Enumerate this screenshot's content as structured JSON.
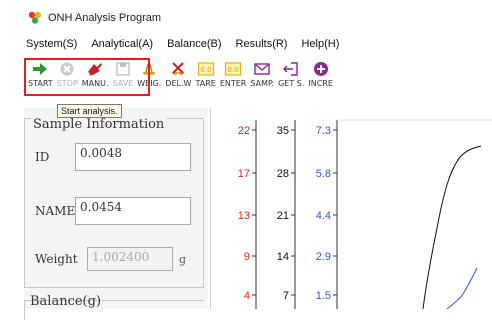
{
  "app": {
    "title": "ONH Analysis Program"
  },
  "menu": [
    "System(S)",
    "Analytical(A)",
    "Balance(B)",
    "Results(R)",
    "Help(H)"
  ],
  "toolbar": {
    "buttons": [
      {
        "label": "START",
        "icon": "arrow-right-icon",
        "enabled": true
      },
      {
        "label": "STOP",
        "icon": "stop-icon",
        "enabled": false
      },
      {
        "label": "MANU.",
        "icon": "manual-icon",
        "enabled": true
      },
      {
        "label": "SAVE",
        "icon": "save-icon",
        "enabled": false
      },
      {
        "label": "WEIG.",
        "icon": "weigh-icon",
        "enabled": true
      },
      {
        "label": "DEL.W",
        "icon": "delete-weigh-icon",
        "enabled": true
      },
      {
        "label": "TARE",
        "icon": "tare-icon",
        "enabled": true
      },
      {
        "label": "ENTER",
        "icon": "enter-icon",
        "enabled": true
      },
      {
        "label": "SAMP.",
        "icon": "sample-icon",
        "enabled": true
      },
      {
        "label": "GET S.",
        "icon": "get-sample-icon",
        "enabled": true
      },
      {
        "label": "INCRE",
        "icon": "increment-icon",
        "enabled": true
      }
    ],
    "tooltip": "Start analysis."
  },
  "sample_info": {
    "title": "Sample Information",
    "id_label": "ID",
    "id_value": "0.0048",
    "name_label": "NAME",
    "name_value": "0.0454",
    "weight_label": "Weight",
    "weight_value": "1.002400",
    "weight_unit": "g"
  },
  "balance": {
    "title": "Balance(g)"
  },
  "chart": {
    "axes": [
      {
        "color": "#e02020",
        "ticks": [
          "22",
          "17",
          "13",
          "9",
          "4"
        ]
      },
      {
        "color": "#111111",
        "ticks": [
          "35",
          "28",
          "21",
          "14",
          "7"
        ]
      },
      {
        "color": "#3355cc",
        "ticks": [
          "7.3",
          "5.8",
          "4.4",
          "2.9",
          "1.5"
        ]
      }
    ]
  },
  "colors": {
    "highlight": "#e02020",
    "accent_blue": "#3355cc",
    "start_green": "#2e9a2e",
    "manual_red": "#c0202a",
    "purple": "#8a2a8a"
  }
}
